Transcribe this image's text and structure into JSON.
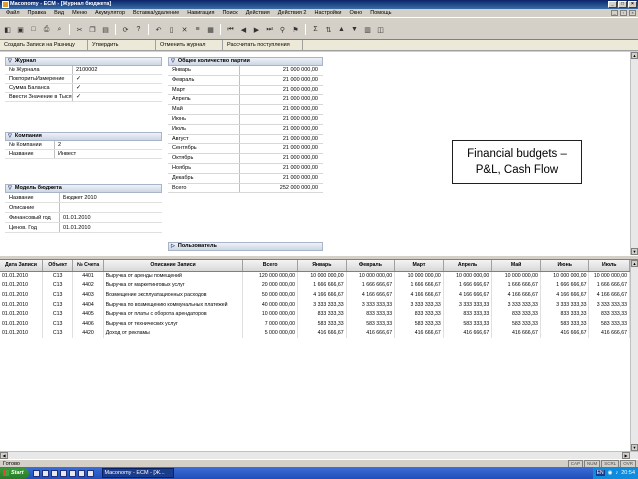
{
  "window": {
    "title": "Maconomy - ECM - [Журнал бюджета]"
  },
  "menu": [
    "Файл",
    "Правка",
    "Вид",
    "Меню",
    "Акумулятор",
    "Вставка/удаление",
    "Навигация",
    "Поиск",
    "Действия",
    "Действия 2",
    "Настройки",
    "Окно",
    "Помощь"
  ],
  "actions": [
    "Создать Записи на Разницу",
    "Утвердить",
    "Отменить журнал",
    "Рассчитать поступления"
  ],
  "journal": {
    "header": "Журнал",
    "rows": [
      {
        "label": "№ Журнала",
        "value": "2100002"
      },
      {
        "label": "ПовторитьИзмерение",
        "value": "✓"
      },
      {
        "label": "Сумма Баланса",
        "value": "✓"
      },
      {
        "label": "Ввести Значение в Тысячах",
        "value": "✓"
      }
    ]
  },
  "company": {
    "header": "Компания",
    "rows": [
      {
        "label": "№ Компании",
        "value": "2"
      },
      {
        "label": "Название",
        "value": "Инвест"
      }
    ]
  },
  "model": {
    "header": "Модель бюджета",
    "rows": [
      {
        "label": "Название",
        "value": "Бюджет 2010"
      },
      {
        "label": "Описание",
        "value": ""
      },
      {
        "label": "Финансовый год",
        "value": "01.01.2010"
      },
      {
        "label": "Ценов. Год",
        "value": "01.01.2010"
      }
    ]
  },
  "periods": {
    "header": "Общее количество партии",
    "rows": [
      {
        "label": "Январь",
        "value": "21 000 000,00"
      },
      {
        "label": "Февраль",
        "value": "21 000 000,00"
      },
      {
        "label": "Март",
        "value": "21 000 000,00"
      },
      {
        "label": "Апрель",
        "value": "21 000 000,00"
      },
      {
        "label": "Май",
        "value": "21 000 000,00"
      },
      {
        "label": "Июнь",
        "value": "21 000 000,00"
      },
      {
        "label": "Июль",
        "value": "21 000 000,00"
      },
      {
        "label": "Август",
        "value": "21 000 000,00"
      },
      {
        "label": "Сентябрь",
        "value": "21 000 000,00"
      },
      {
        "label": "Октябрь",
        "value": "21 000 000,00"
      },
      {
        "label": "Ноябрь",
        "value": "21 000 000,00"
      },
      {
        "label": "Декабрь",
        "value": "21 000 000,00"
      },
      {
        "label": "Всего",
        "value": "252 000 000,00"
      }
    ]
  },
  "user": {
    "header": "Пользователь"
  },
  "callout": {
    "line1": "Financial budgets –",
    "line2": "P&L, Cash Flow"
  },
  "table": {
    "columns": [
      "Дата Записи",
      "Объект",
      "№ Счета",
      "Описание Записи",
      "Всего",
      "Январь",
      "Февраль",
      "Март",
      "Апрель",
      "Май",
      "Июнь",
      "Июль"
    ],
    "rows": [
      [
        "01.01.2010",
        "С13",
        "4401",
        "Выручка от аренды помещений",
        "120 000 000,00",
        "10 000 000,00",
        "10 000 000,00",
        "10 000 000,00",
        "10 000 000,00",
        "10 000 000,00",
        "10 000 000,00",
        "10 000 000,00"
      ],
      [
        "01.01.2010",
        "С13",
        "4402",
        "Выручка от маркетинговых услуг",
        "20 000 000,00",
        "1 666 666,67",
        "1 666 666,67",
        "1 666 666,67",
        "1 666 666,67",
        "1 666 666,67",
        "1 666 666,67",
        "1 666 666,67"
      ],
      [
        "01.01.2010",
        "С13",
        "4403",
        "Возмещение эксплуатационных расходов",
        "50 000 000,00",
        "4 166 666,67",
        "4 166 666,67",
        "4 166 666,67",
        "4 166 666,67",
        "4 166 666,67",
        "4 166 666,67",
        "4 166 666,67"
      ],
      [
        "01.01.2010",
        "С13",
        "4404",
        "Выручка по возмещению коммунальных платежей",
        "40 000 000,00",
        "3 333 333,33",
        "3 333 333,33",
        "3 333 333,33",
        "3 333 333,33",
        "3 333 333,33",
        "3 333 333,33",
        "3 333 333,33"
      ],
      [
        "01.01.2010",
        "С13",
        "4405",
        "Выручка от платы с оборота арендаторов",
        "10 000 000,00",
        "833 333,33",
        "833 333,33",
        "833 333,33",
        "833 333,33",
        "833 333,33",
        "833 333,33",
        "833 333,33"
      ],
      [
        "01.01.2010",
        "С13",
        "4406",
        "Выручка от технических услуг",
        "7 000 000,00",
        "583 333,33",
        "583 333,33",
        "583 333,33",
        "583 333,33",
        "583 333,33",
        "583 333,33",
        "583 333,33"
      ],
      [
        "01.01.2010",
        "С13",
        "4420",
        "Доход от рекламы",
        "5 000 000,00",
        "416 666,67",
        "416 666,67",
        "416 666,67",
        "416 666,67",
        "416 666,67",
        "416 666,67",
        "416 666,67"
      ]
    ]
  },
  "status": {
    "text": "Готово",
    "indicators": [
      "CAP",
      "NUM",
      "SCRL",
      "OVR"
    ]
  },
  "taskbar": {
    "start": "Start",
    "task": "Maconomy - ECM - [Ж...",
    "lang": "EN",
    "time": "20:54"
  }
}
